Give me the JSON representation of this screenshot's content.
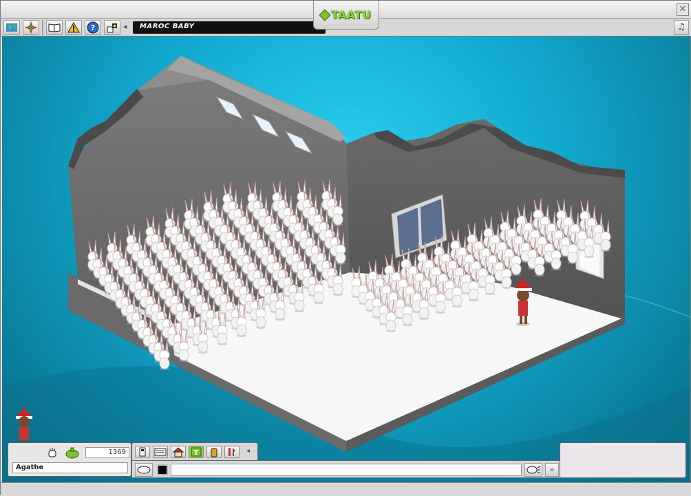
{
  "window": {
    "brand": "TAATU",
    "close_label": "✕"
  },
  "toolbar": {
    "buttons": [
      {
        "name": "navigator-button",
        "icon": "globe-icon"
      },
      {
        "name": "hotel-view-button",
        "icon": "compass-icon"
      },
      {
        "name": "catalog-button",
        "icon": "book-icon"
      },
      {
        "name": "alert-button",
        "icon": "warning-icon"
      },
      {
        "name": "help-button",
        "icon": "help-icon"
      },
      {
        "name": "room-info-button",
        "icon": "room-icon"
      }
    ],
    "collapse_label": "◂",
    "music_label": "♫"
  },
  "room": {
    "name": "MAROC BABY",
    "furniture": "rabbit-plush-grid",
    "colors": {
      "floor": "#f7f7f7",
      "wall": "#6f6f6f",
      "base": "#5d5d5d",
      "background": "#14a9cf"
    }
  },
  "user": {
    "name": "Agathe",
    "credits": "1369"
  },
  "nav_tabs": [
    {
      "name": "tab-messenger",
      "icon": "phone-icon"
    },
    {
      "name": "tab-news",
      "icon": "newspaper-icon"
    },
    {
      "name": "tab-home",
      "icon": "house-icon"
    },
    {
      "name": "tab-taatu",
      "icon": "t-icon"
    },
    {
      "name": "tab-inventory",
      "icon": "jar-icon"
    },
    {
      "name": "tab-tools",
      "icon": "tools-icon"
    }
  ],
  "chat": {
    "placeholder": "",
    "expand_label": "»"
  }
}
